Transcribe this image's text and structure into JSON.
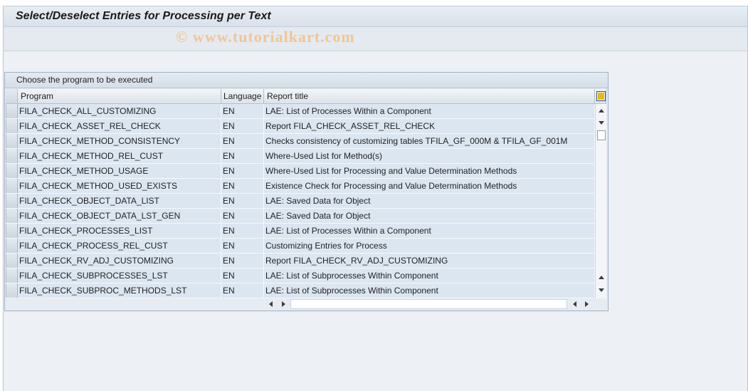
{
  "window": {
    "title": "Select/Deselect Entries for Processing per Text"
  },
  "watermark": "© www.tutorialkart.com",
  "table": {
    "caption": "Choose the program to be executed",
    "columns": {
      "program": "Program",
      "language": "Language",
      "report_title": "Report title"
    },
    "rows": [
      {
        "program": "FILA_CHECK_ALL_CUSTOMIZING",
        "language": "EN",
        "title": "LAE: List of Processes Within a Component"
      },
      {
        "program": "FILA_CHECK_ASSET_REL_CHECK",
        "language": "EN",
        "title": "Report FILA_CHECK_ASSET_REL_CHECK"
      },
      {
        "program": "FILA_CHECK_METHOD_CONSISTENCY",
        "language": "EN",
        "title": "Checks consistency of customizing tables TFILA_GF_000M & TFILA_GF_001M"
      },
      {
        "program": "FILA_CHECK_METHOD_REL_CUST",
        "language": "EN",
        "title": "Where-Used List for Method(s)"
      },
      {
        "program": "FILA_CHECK_METHOD_USAGE",
        "language": "EN",
        "title": "Where-Used List for Processing and Value Determination Methods"
      },
      {
        "program": "FILA_CHECK_METHOD_USED_EXISTS",
        "language": "EN",
        "title": "Existence Check for Processing and Value Determination Methods"
      },
      {
        "program": "FILA_CHECK_OBJECT_DATA_LIST",
        "language": "EN",
        "title": "LAE: Saved Data for Object"
      },
      {
        "program": "FILA_CHECK_OBJECT_DATA_LST_GEN",
        "language": "EN",
        "title": "LAE: Saved Data for Object"
      },
      {
        "program": "FILA_CHECK_PROCESSES_LIST",
        "language": "EN",
        "title": "LAE: List of Processes Within a Component"
      },
      {
        "program": "FILA_CHECK_PROCESS_REL_CUST",
        "language": "EN",
        "title": "Customizing Entries for Process"
      },
      {
        "program": "FILA_CHECK_RV_ADJ_CUSTOMIZING",
        "language": "EN",
        "title": "Report FILA_CHECK_RV_ADJ_CUSTOMIZING"
      },
      {
        "program": "FILA_CHECK_SUBPROCESSES_LST",
        "language": "EN",
        "title": "LAE: List of Subprocesses Within Component"
      },
      {
        "program": "FILA_CHECK_SUBPROC_METHODS_LST",
        "language": "EN",
        "title": "LAE: List of Subprocesses Within Component"
      }
    ]
  },
  "icons": {
    "column_settings": "column-settings-icon",
    "scroll_up": "arrow-up-icon",
    "scroll_down": "arrow-down-icon",
    "scroll_left": "arrow-left-icon",
    "scroll_right": "arrow-right-icon"
  },
  "colors": {
    "title_bar": "#dfe6ee",
    "workspace": "#edf1f5",
    "row_background": "#dbe6f1",
    "watermark": "#f3c592"
  }
}
